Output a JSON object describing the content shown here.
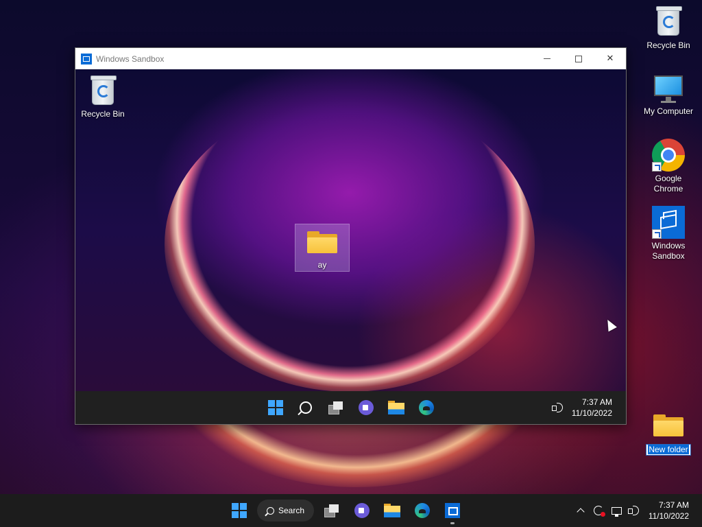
{
  "host_desktop": {
    "icons": [
      {
        "label": "Recycle Bin",
        "icon": "recycle-bin-icon"
      },
      {
        "label": "My Computer",
        "icon": "computer-icon"
      },
      {
        "label": "Google Chrome",
        "icon": "chrome-icon"
      },
      {
        "label": "Windows Sandbox",
        "icon": "sandbox-icon"
      },
      {
        "label": "New folder",
        "icon": "folder-icon",
        "state": "renaming"
      }
    ]
  },
  "sandbox_window": {
    "title": "Windows Sandbox",
    "controls": {
      "minimize": "minimize",
      "maximize": "maximize",
      "close": "✕"
    },
    "desktop_icons": [
      {
        "label": "Recycle Bin",
        "icon": "recycle-bin-icon"
      },
      {
        "label": "ay",
        "icon": "folder-icon",
        "selected": true
      }
    ],
    "taskbar": {
      "apps": [
        "start",
        "search",
        "task-view",
        "chat",
        "file-explorer",
        "edge"
      ],
      "time": "7:37 AM",
      "date": "11/10/2022"
    }
  },
  "host_taskbar": {
    "search_label": "Search",
    "apps": [
      "start",
      "search",
      "task-view",
      "chat",
      "file-explorer",
      "edge",
      "windows-sandbox"
    ],
    "active_app": "windows-sandbox",
    "time": "7:37 AM",
    "date": "11/10/2022"
  },
  "colors": {
    "accent": "#0a6bd6",
    "taskbar": "#1c1c1c",
    "notification_dot": "#e81123"
  }
}
